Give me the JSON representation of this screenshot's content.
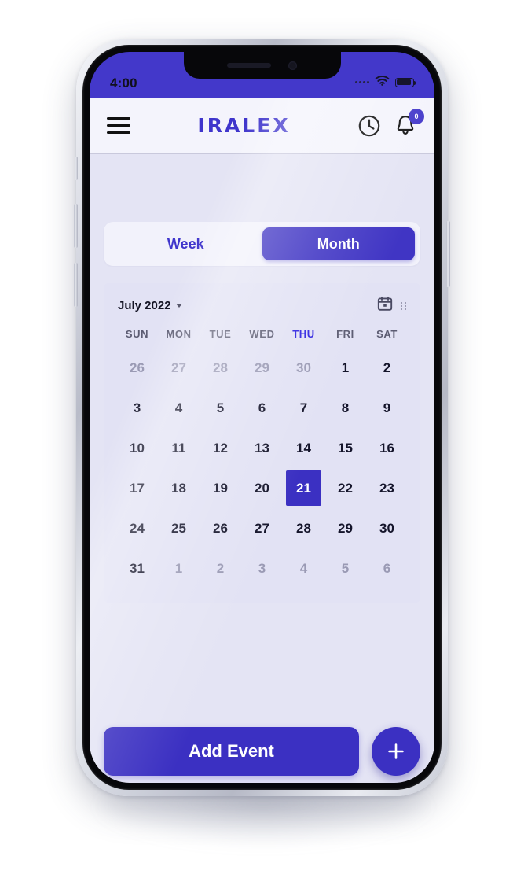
{
  "status_bar": {
    "time": "4:00",
    "icons": [
      "signal-dots",
      "wifi-icon",
      "battery-icon"
    ]
  },
  "app_bar": {
    "menu_icon": "hamburger-menu-icon",
    "brand": "IRALEX",
    "clock_icon": "clock-icon",
    "bell_icon": "bell-icon",
    "notification_count": "0"
  },
  "view_toggle": {
    "options": [
      {
        "label": "Week",
        "active": false
      },
      {
        "label": "Month",
        "active": true
      }
    ]
  },
  "calendar": {
    "month_label": "July 2022",
    "calendar_icon": "calendar-icon",
    "drag_handle_icon": "drag-handle-icon",
    "day_headers": [
      {
        "label": "SUN",
        "today": false
      },
      {
        "label": "MON",
        "today": false
      },
      {
        "label": "TUE",
        "today": false
      },
      {
        "label": "WED",
        "today": false
      },
      {
        "label": "THU",
        "today": true
      },
      {
        "label": "FRI",
        "today": false
      },
      {
        "label": "SAT",
        "today": false
      }
    ],
    "selected_date": "21",
    "weeks": [
      [
        {
          "d": "26",
          "muted": true,
          "selected": false
        },
        {
          "d": "27",
          "muted": true,
          "selected": false
        },
        {
          "d": "28",
          "muted": true,
          "selected": false
        },
        {
          "d": "29",
          "muted": true,
          "selected": false
        },
        {
          "d": "30",
          "muted": true,
          "selected": false
        },
        {
          "d": "1",
          "muted": false,
          "selected": false
        },
        {
          "d": "2",
          "muted": false,
          "selected": false
        }
      ],
      [
        {
          "d": "3",
          "muted": false,
          "selected": false
        },
        {
          "d": "4",
          "muted": false,
          "selected": false
        },
        {
          "d": "5",
          "muted": false,
          "selected": false
        },
        {
          "d": "6",
          "muted": false,
          "selected": false
        },
        {
          "d": "7",
          "muted": false,
          "selected": false
        },
        {
          "d": "8",
          "muted": false,
          "selected": false
        },
        {
          "d": "9",
          "muted": false,
          "selected": false
        }
      ],
      [
        {
          "d": "10",
          "muted": false,
          "selected": false
        },
        {
          "d": "11",
          "muted": false,
          "selected": false
        },
        {
          "d": "12",
          "muted": false,
          "selected": false
        },
        {
          "d": "13",
          "muted": false,
          "selected": false
        },
        {
          "d": "14",
          "muted": false,
          "selected": false
        },
        {
          "d": "15",
          "muted": false,
          "selected": false
        },
        {
          "d": "16",
          "muted": false,
          "selected": false
        }
      ],
      [
        {
          "d": "17",
          "muted": false,
          "selected": false
        },
        {
          "d": "18",
          "muted": false,
          "selected": false
        },
        {
          "d": "19",
          "muted": false,
          "selected": false
        },
        {
          "d": "20",
          "muted": false,
          "selected": false
        },
        {
          "d": "21",
          "muted": false,
          "selected": true
        },
        {
          "d": "22",
          "muted": false,
          "selected": false
        },
        {
          "d": "23",
          "muted": false,
          "selected": false
        }
      ],
      [
        {
          "d": "24",
          "muted": false,
          "selected": false
        },
        {
          "d": "25",
          "muted": false,
          "selected": false
        },
        {
          "d": "26",
          "muted": false,
          "selected": false
        },
        {
          "d": "27",
          "muted": false,
          "selected": false
        },
        {
          "d": "28",
          "muted": false,
          "selected": false
        },
        {
          "d": "29",
          "muted": false,
          "selected": false
        },
        {
          "d": "30",
          "muted": false,
          "selected": false
        }
      ],
      [
        {
          "d": "31",
          "muted": false,
          "selected": false
        },
        {
          "d": "1",
          "muted": true,
          "selected": false
        },
        {
          "d": "2",
          "muted": true,
          "selected": false
        },
        {
          "d": "3",
          "muted": true,
          "selected": false
        },
        {
          "d": "4",
          "muted": true,
          "selected": false
        },
        {
          "d": "5",
          "muted": true,
          "selected": false
        },
        {
          "d": "6",
          "muted": true,
          "selected": false
        }
      ]
    ]
  },
  "bottom_bar": {
    "add_event_label": "Add Event",
    "fab_icon": "plus-icon"
  },
  "colors": {
    "accent": "#3b30c2",
    "status_bar": "#4338ca",
    "app_bg": "#e4e4f4",
    "app_bar_bg": "#f4f4fc",
    "today_text": "#2c21e0",
    "muted_text": "#9a9ab4"
  }
}
